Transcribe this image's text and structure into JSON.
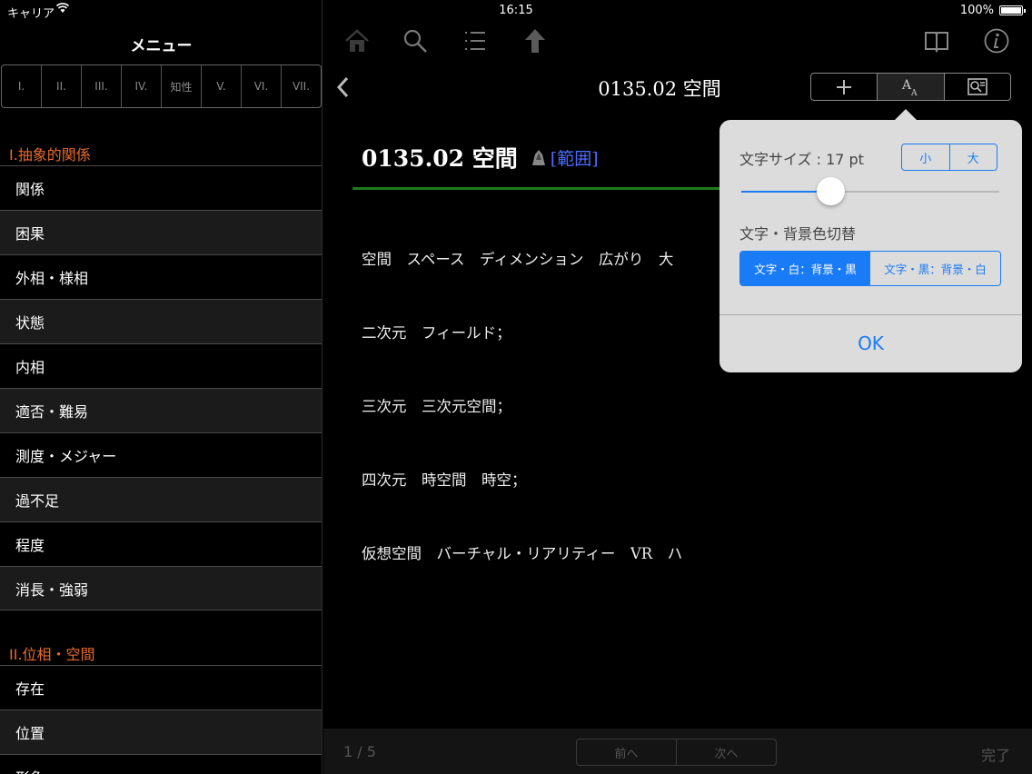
{
  "status_bar": {
    "carrier": "キャリア",
    "time": "16:15",
    "battery": "100%"
  },
  "sidebar": {
    "title": "メニュー",
    "volume_tabs": [
      "I.",
      "II.",
      "III.",
      "IV.",
      "知性",
      "V.",
      "VI.",
      "VII."
    ],
    "sections": [
      {
        "header": "I.抽象的関係",
        "items": [
          "関係",
          "困果",
          "外相・様相",
          "状態",
          "内相",
          "適否・難易",
          "測度・メジャー",
          "過不足",
          "程度",
          "消長・強弱"
        ]
      },
      {
        "header": "II.位相・空間",
        "items": [
          "存在",
          "位置",
          "形象"
        ]
      }
    ]
  },
  "toolbar": {
    "icons": [
      "home-icon",
      "search-icon",
      "list-icon",
      "up-arrow-icon",
      "book-icon",
      "info-icon"
    ],
    "doc_title": "0135.02 空間",
    "seg_icons": [
      "plus-icon",
      "text-size-icon",
      "search-document-icon"
    ]
  },
  "entry": {
    "title": "0135.02  空間",
    "range_link": "[範囲]",
    "lines": [
      "空間　スペース　ディメンション　広がり　大",
      "二次元　フィールド；",
      "三次元　三次元空間；",
      "四次元　時空間　時空；",
      "仮想空間　バーチャル・リアリティー　VR　ハ"
    ]
  },
  "bottom_bar": {
    "page": "1 / 5",
    "prev": "前へ",
    "next": "次へ",
    "done": "完了"
  },
  "popover": {
    "size_label": "文字サイズ : 17 pt",
    "size_small": "小",
    "size_large": "大",
    "slider_value": 0.33,
    "color_label": "文字・背景色切替",
    "color_options": [
      "文字・白：背景・黒",
      "文字・黒：背景・白"
    ],
    "color_selected_index": 0,
    "ok": "OK",
    "accent_color": "#1a7bf6"
  }
}
